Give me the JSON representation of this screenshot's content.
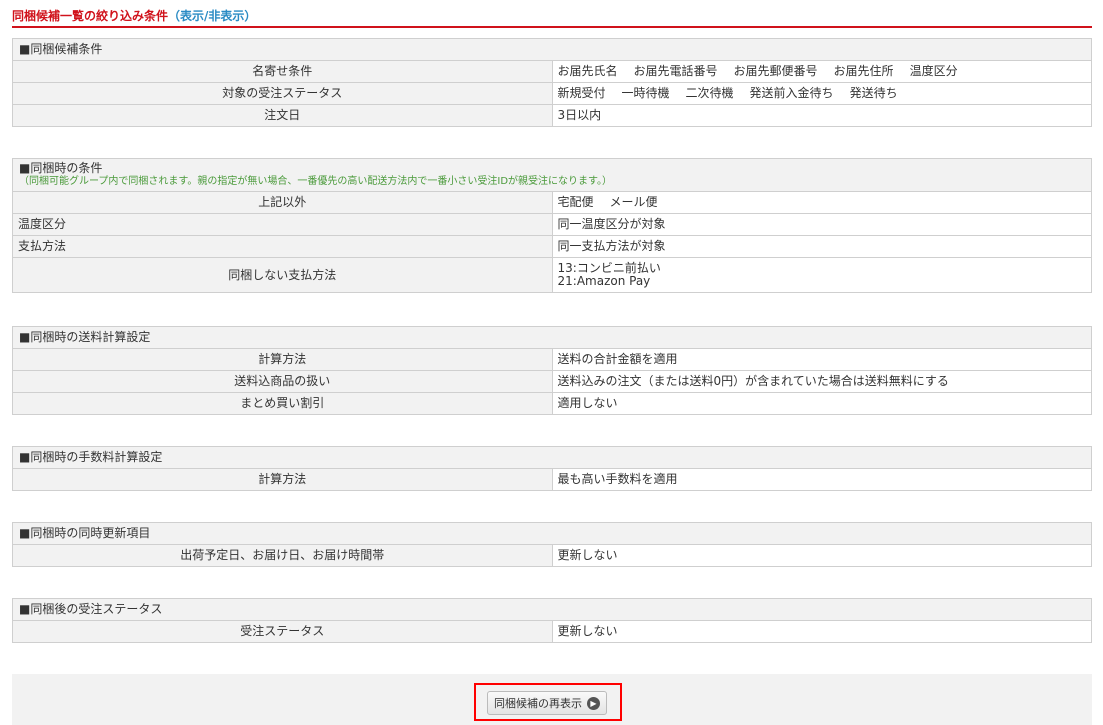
{
  "header": {
    "title": "同梱候補一覧の絞り込み条件",
    "toggle_open": "（",
    "toggle_label": "表示/非表示",
    "toggle_close": "）"
  },
  "sections": [
    {
      "title": "■同梱候補条件",
      "rows": [
        {
          "label": "名寄せ条件",
          "values": [
            "お届先氏名",
            "お届先電話番号",
            "お届先郵便番号",
            "お届先住所",
            "温度区分"
          ]
        },
        {
          "label": "対象の受注ステータス",
          "values": [
            "新規受付",
            "一時待機",
            "二次待機",
            "発送前入金待ち",
            "発送待ち"
          ]
        },
        {
          "label": "注文日",
          "values": [
            "3日以内"
          ]
        }
      ]
    },
    {
      "title": "■同梱時の条件",
      "note": "（同梱可能グループ内で同梱されます。親の指定が無い場合、一番優先の高い配送方法内で一番小さい受注IDが親受注になります。）",
      "rows": [
        {
          "label": "上記以外",
          "values": [
            "宅配便",
            "メール便"
          ]
        },
        {
          "label": "温度区分",
          "align": "left",
          "values": [
            "同一温度区分が対象"
          ]
        },
        {
          "label": "支払方法",
          "align": "left",
          "values": [
            "同一支払方法が対象"
          ]
        },
        {
          "label": "同梱しない支払方法",
          "values": [
            "13:コンビニ前払い",
            "21:Amazon Pay"
          ],
          "stack": true
        }
      ]
    },
    {
      "title": "■同梱時の送料計算設定",
      "rows": [
        {
          "label": "計算方法",
          "values": [
            "送料の合計金額を適用"
          ]
        },
        {
          "label": "送料込商品の扱い",
          "values": [
            "送料込みの注文（または送料0円）が含まれていた場合は送料無料にする"
          ]
        },
        {
          "label": "まとめ買い割引",
          "values": [
            "適用しない"
          ]
        }
      ]
    },
    {
      "title": "■同梱時の手数料計算設定",
      "rows": [
        {
          "label": "計算方法",
          "values": [
            "最も高い手数料を適用"
          ]
        }
      ]
    },
    {
      "title": "■同梱時の同時更新項目",
      "rows": [
        {
          "label": "出荷予定日、お届け日、お届け時間帯",
          "values": [
            "更新しない"
          ]
        }
      ]
    },
    {
      "title": "■同梱後の受注ステータス",
      "rows": [
        {
          "label": "受注ステータス",
          "values": [
            "更新しない"
          ]
        }
      ]
    }
  ],
  "footer": {
    "redisplay_button": "同梱候補の再表示"
  }
}
